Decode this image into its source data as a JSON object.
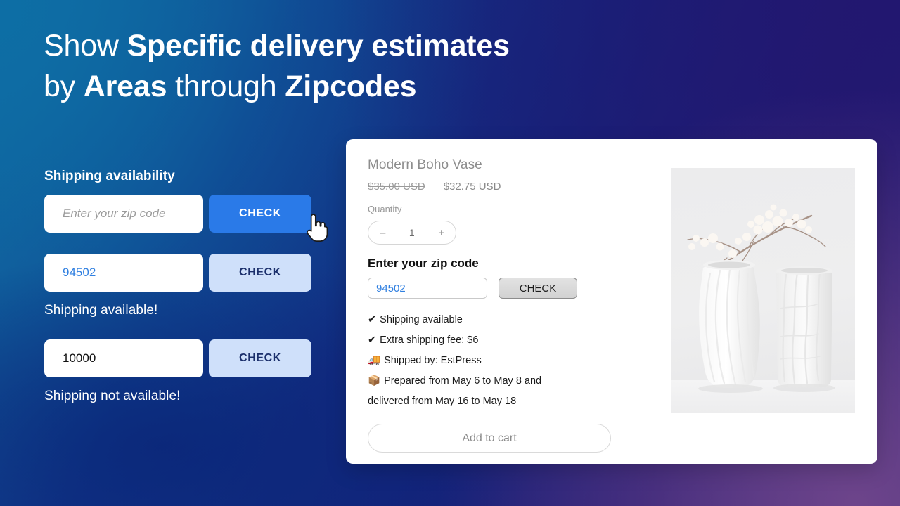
{
  "headline": {
    "line1_part1": "Show ",
    "line1_strong1": "Specific delivery estimates",
    "line2_part1": "by ",
    "line2_strong1": "Areas",
    "line2_part2": " through ",
    "line2_strong2": "Zipcodes"
  },
  "colors": {
    "accent_blue": "#2a7ae8",
    "light_blue_button": "#cfe0fa",
    "bg_top_left": "#1268a0",
    "bg_top_right": "#221a72",
    "bg_bottom_left": "#13307e",
    "bg_bottom_right": "#533a75",
    "value_blue": "#2f7fe0"
  },
  "left_panel": {
    "title": "Shipping availability",
    "rows": [
      {
        "input_value": "",
        "input_placeholder": "Enter your zip code",
        "button_label": "CHECK",
        "result": "",
        "cursor_icon": "pointing-hand-cursor"
      },
      {
        "input_value": "94502",
        "input_placeholder": "",
        "button_label": "CHECK",
        "result": "Shipping available!"
      },
      {
        "input_value": "10000",
        "input_placeholder": "",
        "button_label": "CHECK",
        "result": "Shipping not available!"
      }
    ]
  },
  "product_card": {
    "title": "Modern Boho Vase",
    "price_old": "$35.00 USD",
    "price_new": "$32.75 USD",
    "quantity_label": "Quantity",
    "quantity_decrease": "–",
    "quantity_value": "1",
    "quantity_increase": "+",
    "zip_label": "Enter your zip code",
    "zip_value": "94502",
    "zip_placeholder": "",
    "check_label": "CHECK",
    "shipping_lines": [
      {
        "icon": "check-mark-icon",
        "glyph": "✔",
        "text": "Shipping available"
      },
      {
        "icon": "check-mark-icon",
        "glyph": "✔",
        "text": "Extra shipping fee: $6"
      },
      {
        "icon": "delivery-truck-icon",
        "glyph": "🚚",
        "text": "Shipped by: EstPress"
      },
      {
        "icon": "package-box-icon",
        "glyph": "📦",
        "text": "Prepared from May 6 to May 8 and"
      }
    ],
    "shipping_continuation": "delivered from May 16 to May 18",
    "add_to_cart_label": "Add to cart",
    "product_image_alt": "two white textured ceramic vases with dried blossom branches"
  }
}
